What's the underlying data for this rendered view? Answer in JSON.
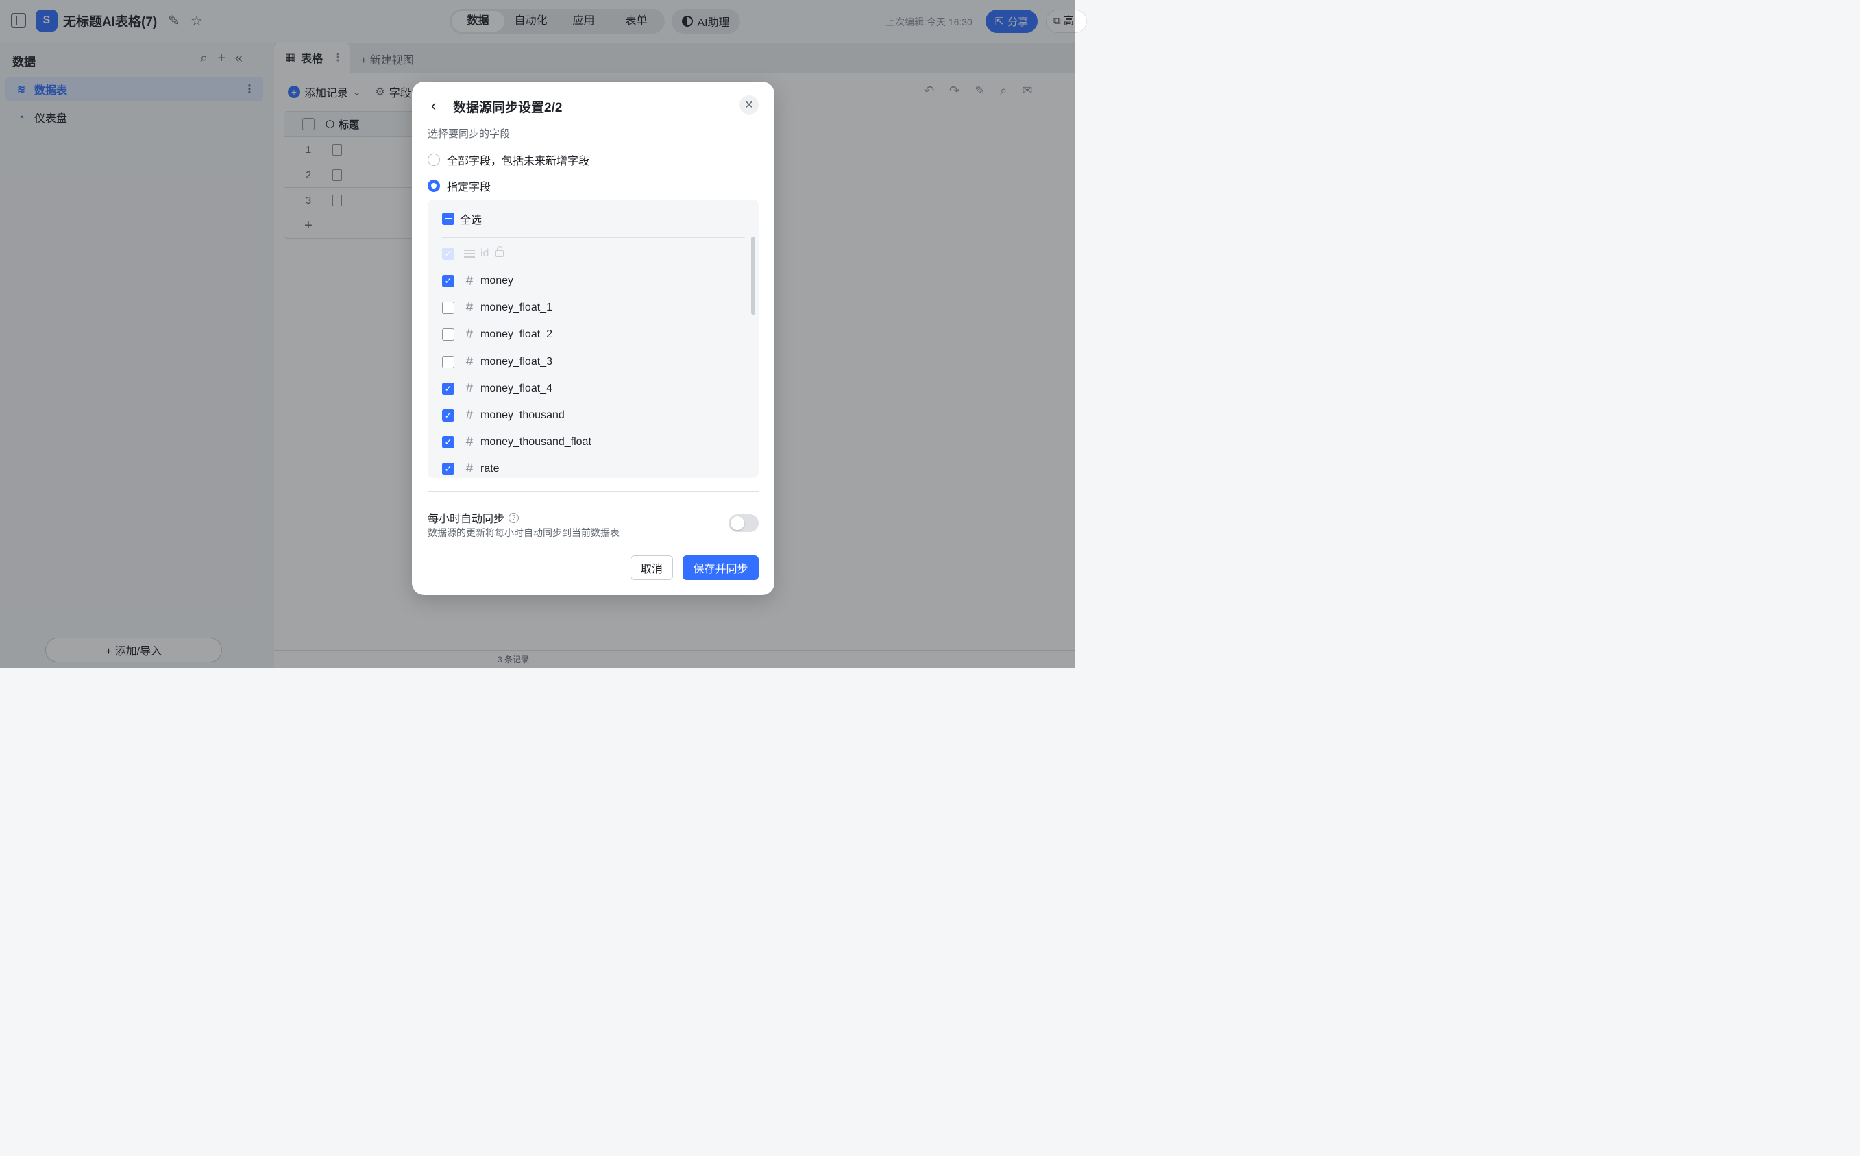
{
  "topbar": {
    "doc_title": "无标题AI表格(7)",
    "logo_icon": "table-logo-icon",
    "tabs": [
      {
        "label": "数据",
        "active": true
      },
      {
        "label": "自动化",
        "active": false
      },
      {
        "label": "应用",
        "active": false
      },
      {
        "label": "表单",
        "active": false
      }
    ],
    "ai_assistant_label": "AI助理",
    "last_edit": "上次编辑:今天 16:30",
    "share_label": "分享",
    "advanced_label": "高"
  },
  "sidebar": {
    "header": "数据",
    "items": [
      {
        "label": "数据表",
        "icon": "database-icon",
        "active": true
      },
      {
        "label": "仪表盘",
        "icon": "dashboard-icon",
        "active": false
      }
    ],
    "add_import_label": "+ 添加/导入"
  },
  "main": {
    "view_tab_label": "表格",
    "new_view_label": "+ 新建视图",
    "add_record_label": "添加记录",
    "field_config_label": "字段",
    "grid": {
      "header": "标题",
      "rows": [
        "1",
        "2",
        "3"
      ],
      "add_row": "+"
    },
    "footer_count": "3 条记录"
  },
  "modal": {
    "title": "数据源同步设置2/2",
    "subtitle": "选择要同步的字段",
    "radio_all": "全部字段，包括未来新增字段",
    "radio_specific": "指定字段",
    "selected_mode": "specific",
    "select_all_label": "全选",
    "fields": [
      {
        "name": "id",
        "type": "text",
        "checked": true,
        "disabled": true,
        "locked": true
      },
      {
        "name": "money",
        "type": "number",
        "checked": true
      },
      {
        "name": "money_float_1",
        "type": "number",
        "checked": false
      },
      {
        "name": "money_float_2",
        "type": "number",
        "checked": false
      },
      {
        "name": "money_float_3",
        "type": "number",
        "checked": false
      },
      {
        "name": "money_float_4",
        "type": "number",
        "checked": true
      },
      {
        "name": "money_thousand",
        "type": "number",
        "checked": true
      },
      {
        "name": "money_thousand_float",
        "type": "number",
        "checked": true
      },
      {
        "name": "rate",
        "type": "number",
        "checked": true
      }
    ],
    "hourly_sync_title": "每小时自动同步",
    "hourly_sync_desc": "数据源的更新将每小时自动同步到当前数据表",
    "hourly_sync_enabled": false,
    "cancel_label": "取消",
    "save_label": "保存并同步"
  },
  "colors": {
    "accent": "#3370ff",
    "overlay": "#1f2329"
  }
}
